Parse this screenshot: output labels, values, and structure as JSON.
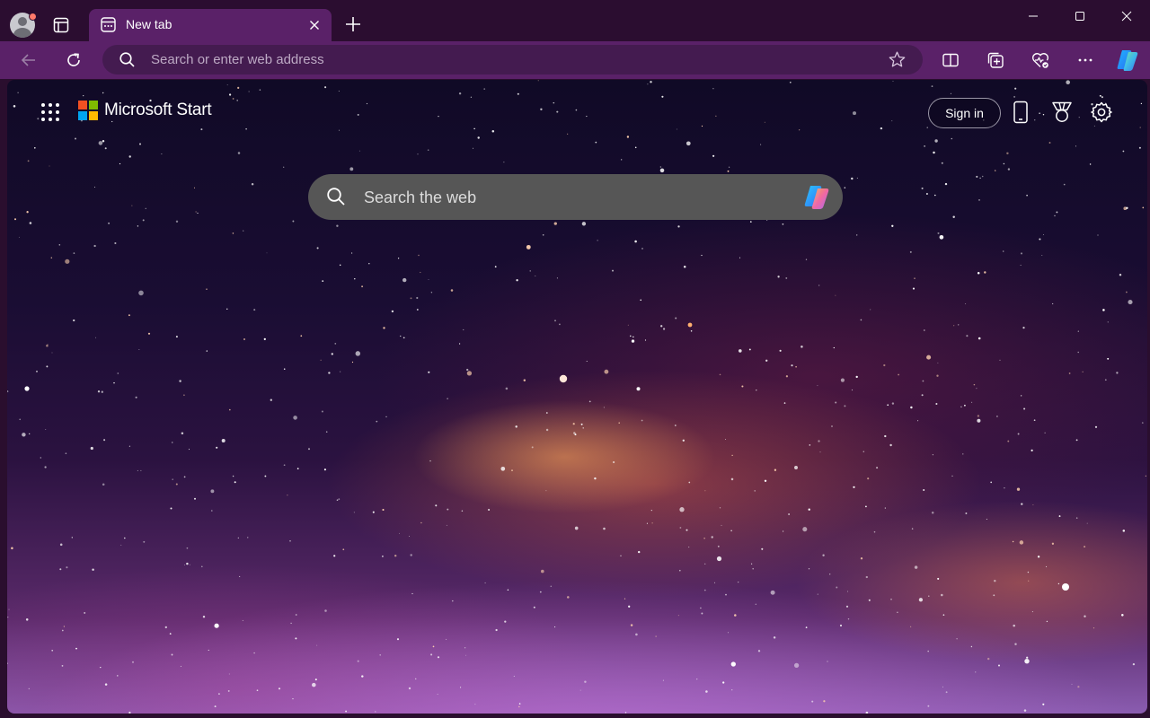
{
  "browser": {
    "tab": {
      "title": "New tab",
      "icon": "new-tab-page-icon"
    },
    "address_bar": {
      "placeholder": "Search or enter web address",
      "value": ""
    },
    "colors": {
      "frame": "#2b0d30",
      "toolbar": "#5a2168",
      "address": "#441b50"
    }
  },
  "page": {
    "brand": "Microsoft Start",
    "sign_in_label": "Sign in",
    "search": {
      "placeholder": "Search the web"
    },
    "header_icons": [
      "phone-icon",
      "rewards-icon",
      "settings-gear-icon"
    ]
  }
}
